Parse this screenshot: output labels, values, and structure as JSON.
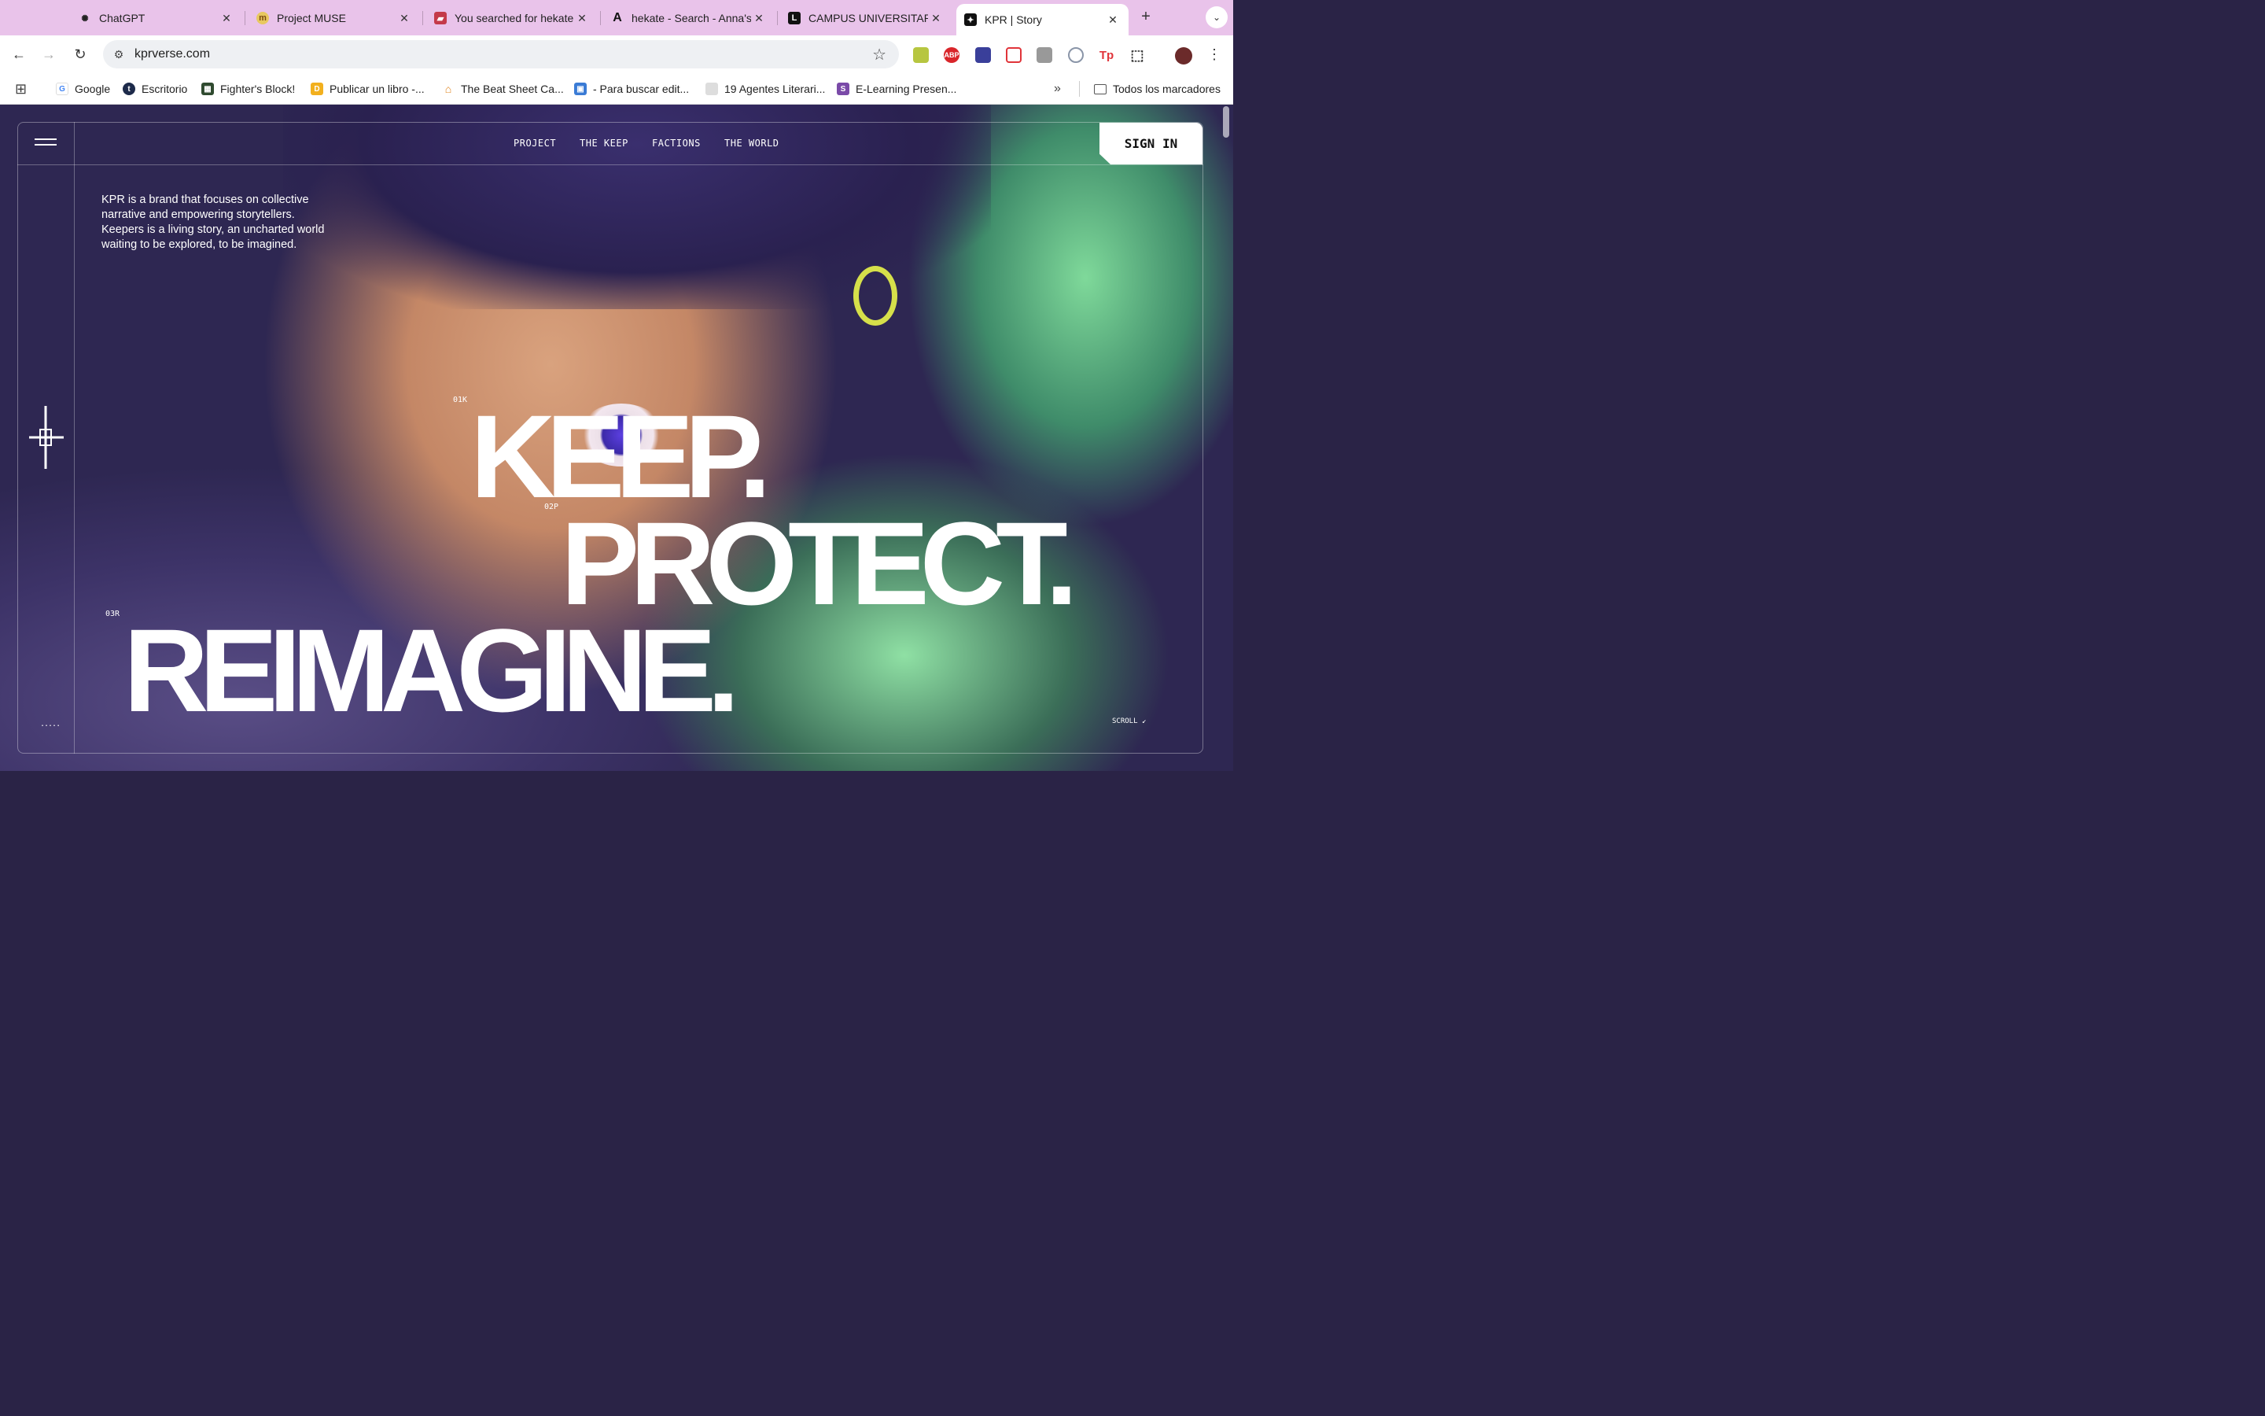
{
  "browser": {
    "tabs": [
      {
        "title": "ChatGPT",
        "icon": "chatgpt-icon"
      },
      {
        "title": "Project MUSE",
        "icon": "project-muse-icon"
      },
      {
        "title": "You searched for hekate",
        "icon": "book-icon"
      },
      {
        "title": "hekate - Search - Anna's",
        "icon": "annas-archive-icon"
      },
      {
        "title": "CAMPUS UNIVERSITARIO",
        "icon": "campus-icon"
      },
      {
        "title": "KPR | Story",
        "icon": "kpr-icon",
        "active": true
      }
    ],
    "url": "kprverse.com",
    "extensions_badge": {
      "abp": "ABP",
      "tp": "Tp"
    },
    "bookmarks": [
      {
        "label": "Google",
        "icon": "google-icon"
      },
      {
        "label": "Escritorio",
        "icon": "tumblr-icon"
      },
      {
        "label": "Fighter's Block!",
        "icon": "fighters-block-icon"
      },
      {
        "label": "Publicar un libro -...",
        "icon": "publish-icon"
      },
      {
        "label": "The Beat Sheet Ca...",
        "icon": "beat-sheet-icon"
      },
      {
        "label": "- Para buscar edit...",
        "icon": "editorial-icon"
      },
      {
        "label": "19 Agentes Literari...",
        "icon": "agents-icon"
      },
      {
        "label": "E-Learning Presen...",
        "icon": "elearning-icon"
      }
    ],
    "bookmarks_folder": "Todos los marcadores"
  },
  "site": {
    "nav": [
      "PROJECT",
      "THE KEEP",
      "FACTIONS",
      "THE WORLD"
    ],
    "signin": "SIGN IN",
    "intro": "KPR is a brand that focuses on collective narrative and empowering storytellers. Keepers is a living story, an uncharted world waiting to be explored, to be imagined.",
    "headline": [
      {
        "tag": "01K",
        "word": "KEEP."
      },
      {
        "tag": "02P",
        "word": "PROTECT."
      },
      {
        "tag": "03R",
        "word": "REIMAGINE."
      }
    ],
    "scroll_label": "SCROLL",
    "dots": "....."
  },
  "colors": {
    "tabstrip": "#e9c3ea",
    "page_bg": "#5b4f93",
    "accent_green": "#7fd99a",
    "signin_bg": "#ffffff"
  }
}
